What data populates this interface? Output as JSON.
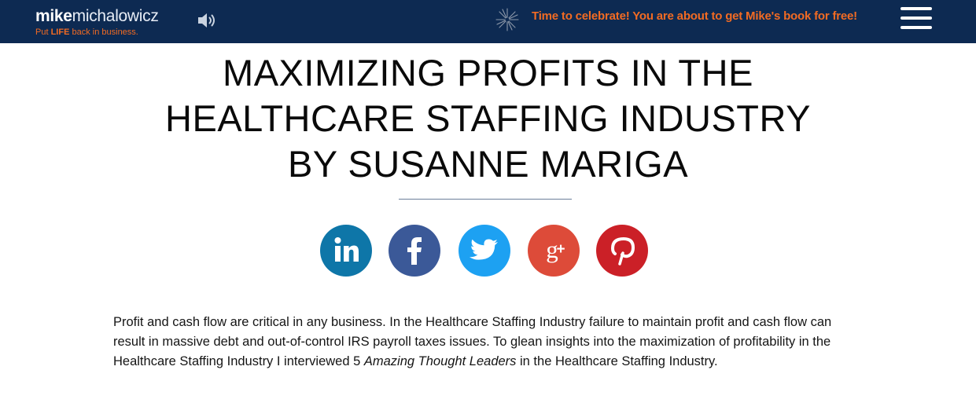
{
  "header": {
    "logo": {
      "bold": "mike",
      "light": "michalowicz"
    },
    "tagline": {
      "pre": "Put ",
      "highlight": "LIFE",
      "post": " back in business."
    },
    "promo_text": "Time to celebrate! You are about to get Mike's book for free!",
    "icons": {
      "sound": "speaker-icon",
      "celebrate": "fireworks-icon",
      "menu": "hamburger-menu-icon"
    },
    "colors": {
      "bar": "#0d2a52",
      "accent": "#f26b23"
    }
  },
  "article": {
    "title_lines": [
      "MAXIMIZING PROFITS IN THE",
      "HEALTHCARE STAFFING INDUSTRY",
      "BY SUSANNE MARIGA"
    ],
    "intro": {
      "part1": "Profit and cash flow are critical in any business.  In the Healthcare Staffing Industry failure to maintain profit and cash flow can result in massive debt and out-of-control IRS payroll taxes issues.  To glean insights into the maximization of profitability in the Healthcare Staffing Industry I interviewed 5 ",
      "emphasis": "Amazing Thought Leaders",
      "part2": " in the Healthcare Staffing Industry."
    }
  },
  "share": [
    {
      "network": "LinkedIn",
      "icon": "linkedin-icon",
      "color": "#0e76a8"
    },
    {
      "network": "Facebook",
      "icon": "facebook-icon",
      "color": "#3b5998"
    },
    {
      "network": "Twitter",
      "icon": "twitter-icon",
      "color": "#1da1f2"
    },
    {
      "network": "Google+",
      "icon": "google-plus-icon",
      "color": "#dd4b39"
    },
    {
      "network": "Pinterest",
      "icon": "pinterest-icon",
      "color": "#cb2027"
    }
  ]
}
